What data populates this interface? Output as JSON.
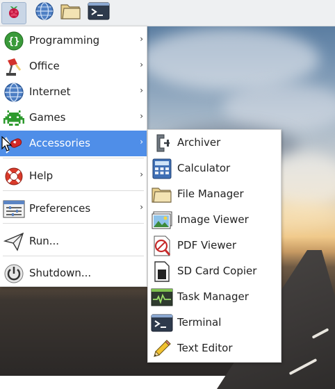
{
  "taskbar": {
    "buttons": [
      {
        "name": "raspberry-pi-menu",
        "icon": "raspberry-icon"
      },
      {
        "name": "web-browser",
        "icon": "globe-icon"
      },
      {
        "name": "file-manager",
        "icon": "folder-icon"
      },
      {
        "name": "terminal",
        "icon": "terminal-icon"
      }
    ]
  },
  "main_menu": {
    "items": [
      {
        "label": "Programming",
        "icon": "programming-icon",
        "submenu": true
      },
      {
        "label": "Office",
        "icon": "office-lamp-icon",
        "submenu": true
      },
      {
        "label": "Internet",
        "icon": "globe-icon",
        "submenu": true
      },
      {
        "label": "Games",
        "icon": "space-invader-icon",
        "submenu": true
      },
      {
        "label": "Accessories",
        "icon": "swiss-knife-icon",
        "submenu": true,
        "active": true
      },
      {
        "label": "Help",
        "icon": "lifebuoy-icon",
        "submenu": true
      },
      {
        "label": "Preferences",
        "icon": "preferences-icon",
        "submenu": true
      },
      {
        "label": "Run...",
        "icon": "paper-plane-icon",
        "submenu": false
      },
      {
        "label": "Shutdown...",
        "icon": "power-icon",
        "submenu": false
      }
    ],
    "arrow_glyph": "›"
  },
  "accessories_menu": {
    "items": [
      {
        "label": "Archiver",
        "icon": "clamp-icon"
      },
      {
        "label": "Calculator",
        "icon": "calculator-icon"
      },
      {
        "label": "File Manager",
        "icon": "folder-icon"
      },
      {
        "label": "Image Viewer",
        "icon": "image-icon"
      },
      {
        "label": "PDF Viewer",
        "icon": "pdf-icon"
      },
      {
        "label": "SD Card Copier",
        "icon": "sd-card-icon"
      },
      {
        "label": "Task Manager",
        "icon": "task-monitor-icon"
      },
      {
        "label": "Terminal",
        "icon": "terminal-icon"
      },
      {
        "label": "Text Editor",
        "icon": "pencil-icon"
      }
    ]
  },
  "colors": {
    "highlight": "#4f8ee8",
    "taskbar_bg": "#eef0f2",
    "menu_bg": "#ffffff"
  }
}
